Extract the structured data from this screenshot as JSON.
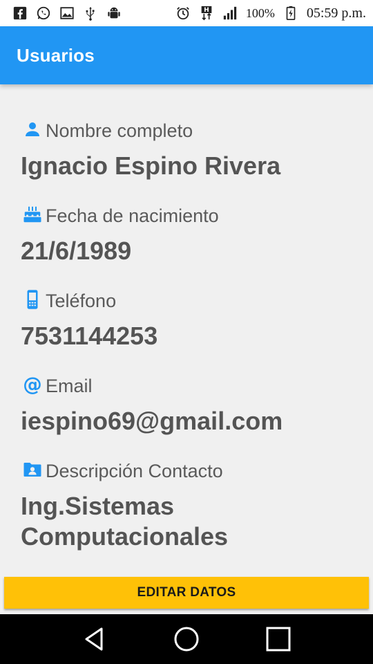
{
  "status_bar": {
    "battery": "100%",
    "time": "05:59 p.m."
  },
  "app_bar": {
    "title": "Usuarios"
  },
  "fields": {
    "name": {
      "label": "Nombre completo",
      "value": "Ignacio Espino Rivera",
      "icon": "person-icon"
    },
    "birthdate": {
      "label": "Fecha de nacimiento",
      "value": "21/6/1989",
      "icon": "cake-icon"
    },
    "phone": {
      "label": "Teléfono",
      "value": "7531144253",
      "icon": "phone-icon"
    },
    "email": {
      "label": "Email",
      "value": "iespino69@gmail.com",
      "icon": "at-icon"
    },
    "description": {
      "label": "Descripción Contacto",
      "value": "Ing.Sistemas Computacionales",
      "icon": "contact-folder-icon"
    }
  },
  "actions": {
    "edit_label": "EDITAR DATOS"
  },
  "colors": {
    "app_bar": "#2196f3",
    "button": "#ffc107",
    "background": "#f0f0f0",
    "icon": "#2196f3"
  }
}
